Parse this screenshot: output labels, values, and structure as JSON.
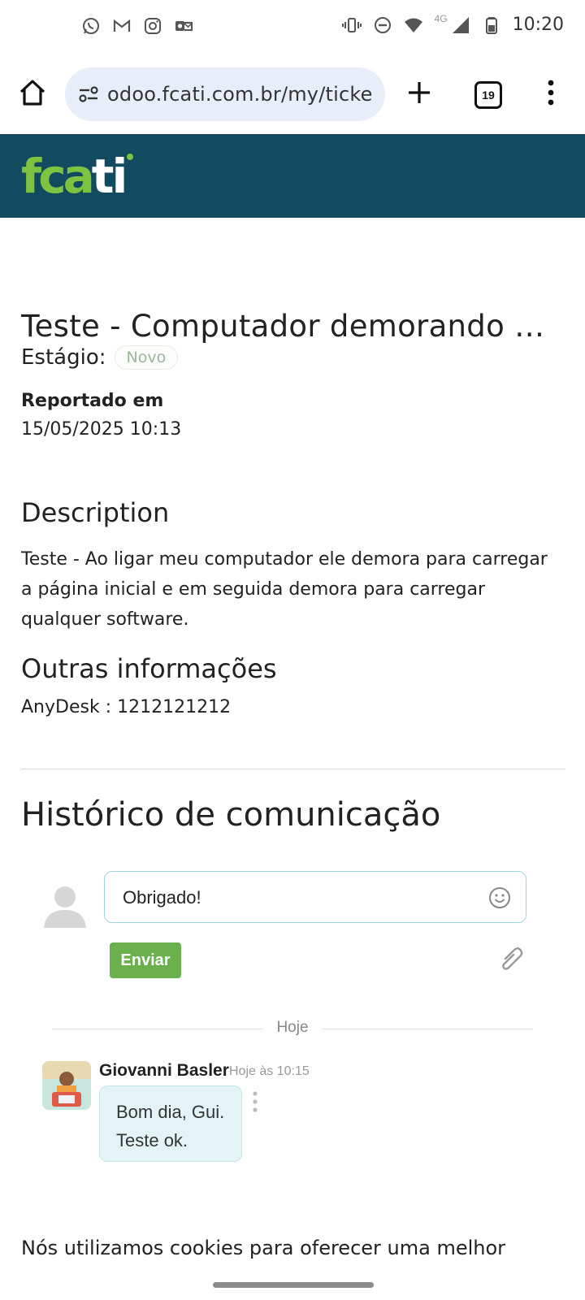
{
  "status_bar": {
    "left_icons": [
      "whatsapp-icon",
      "gmail-icon",
      "instagram-icon",
      "outlook-icon"
    ],
    "right_icons": [
      "vibrate-icon",
      "dnd-icon",
      "wifi-icon",
      "signal-icon",
      "battery-icon"
    ],
    "network_label": "4G",
    "time": "10:20"
  },
  "browser": {
    "url": "odoo.fcati.com.br/my/ticke",
    "tab_count": "19"
  },
  "site": {
    "logo_text_green": "fca",
    "logo_text_white": "ti",
    "brand_color": "#124b5f",
    "accent_color": "#7ec242"
  },
  "ticket": {
    "title": "Teste - Computador demorando para carregar",
    "stage_label": "Estágio:",
    "stage_value": "Novo",
    "reported_label": "Reportado em",
    "reported_value": "15/05/2025 10:13",
    "description_heading": "Description",
    "description_text": "Teste - Ao ligar meu computador ele demora para carregar a página inicial e em seguida demora para carregar qualquer software.",
    "other_heading": "Outras informações",
    "other_text": "AnyDesk : 1212121212"
  },
  "chatter": {
    "heading": "Histórico de comunicação",
    "composer_value": "Obrigado!",
    "send_label": "Enviar",
    "day_separator": "Hoje",
    "messages": [
      {
        "author": "Giovanni Basler",
        "time": "Hoje às 10:15",
        "line1": "Bom dia, Gui.",
        "line2": "Teste ok."
      }
    ]
  },
  "cookie_banner": {
    "text": "Nós utilizamos cookies para oferecer uma melhor"
  }
}
